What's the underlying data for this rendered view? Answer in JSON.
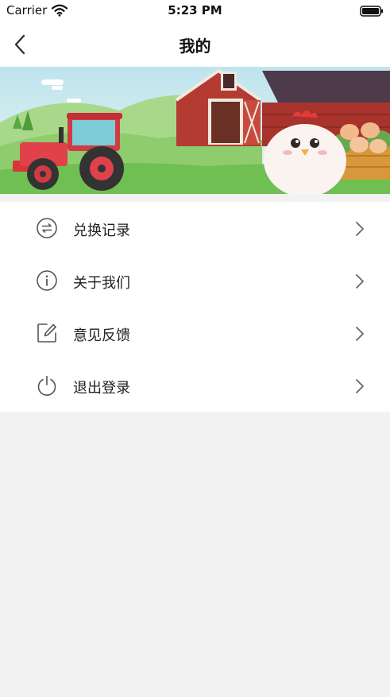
{
  "status_bar": {
    "carrier": "Carrier",
    "time": "5:23 PM",
    "icons": [
      "wifi-icon",
      "battery-icon"
    ]
  },
  "nav": {
    "title": "我的",
    "back_icon": "chevron-left-icon"
  },
  "banner": {
    "illustration": "farm-banner"
  },
  "menu": {
    "items": [
      {
        "label": "兑换记录",
        "icon": "exchange-icon"
      },
      {
        "label": "关于我们",
        "icon": "info-icon"
      },
      {
        "label": "意见反馈",
        "icon": "edit-icon"
      },
      {
        "label": "退出登录",
        "icon": "power-icon"
      }
    ],
    "chevron_icon": "chevron-right-icon"
  },
  "colors": {
    "page_background": "#f2f2f2",
    "surface": "#ffffff",
    "text_primary": "#222222",
    "icon_gray": "#555555",
    "chevron_gray": "#666666"
  }
}
